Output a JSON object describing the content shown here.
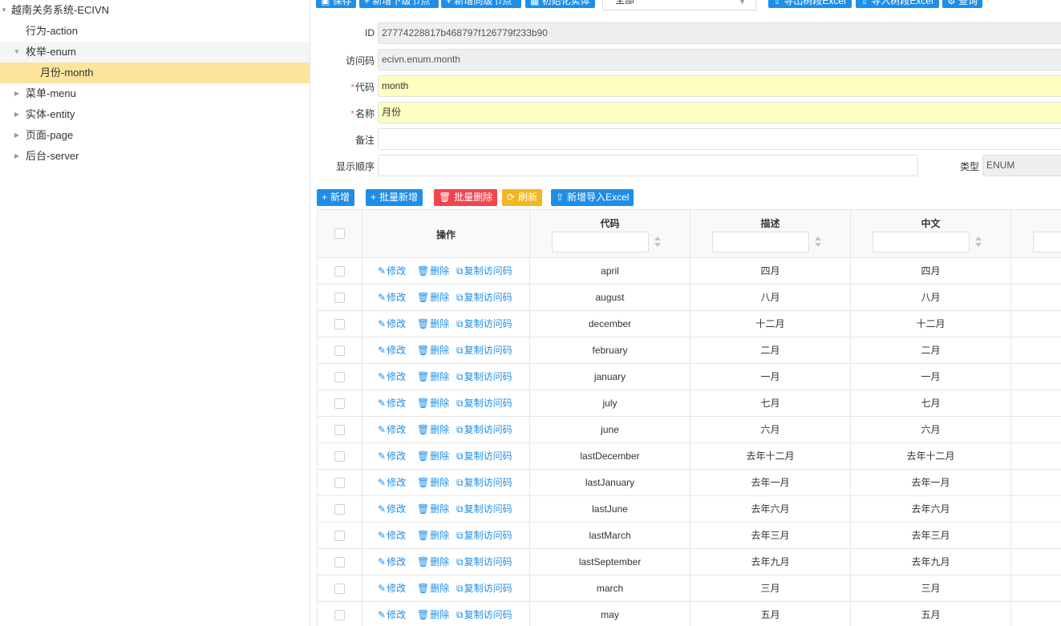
{
  "tree": {
    "root_label": "越南关务系统-ECIVN",
    "items": [
      {
        "label": "行为-action",
        "expanded": false,
        "has_children": false
      },
      {
        "label": "枚举-enum",
        "expanded": true,
        "has_children": true
      },
      {
        "label": "月份-month",
        "selected": true,
        "has_children": false
      },
      {
        "label": "菜单-menu",
        "expanded": false,
        "has_children": true
      },
      {
        "label": "实体-entity",
        "expanded": false,
        "has_children": true
      },
      {
        "label": "页面-page",
        "expanded": false,
        "has_children": true
      },
      {
        "label": "后台-server",
        "expanded": false,
        "has_children": true
      }
    ]
  },
  "toolbar": {
    "save": "保存",
    "add_child": "新增下级节点",
    "add_sibling": "新增同级节点",
    "init_entity": "初始化实体",
    "filter_value": "全部",
    "export_excel": "导出树段Excel",
    "import_excel": "导入树段Excel",
    "query": "查询"
  },
  "form": {
    "id_label": "ID",
    "id_value": "27774228817b468797f126779f233b90",
    "access_label": "访问码",
    "access_value": "ecivn.enum.month",
    "code_label": "代码",
    "code_value": "month",
    "name_label": "名称",
    "name_value": "月份",
    "remark_label": "备注",
    "remark_value": "",
    "order_label": "显示顺序",
    "order_value": "",
    "type_label": "类型",
    "type_value": "ENUM"
  },
  "actions": {
    "add": "新增",
    "batch_add": "批量新增",
    "batch_delete": "批量删除",
    "refresh": "刷新",
    "import_excel": "新增导入Excel"
  },
  "table": {
    "headers": {
      "op": "操作",
      "code": "代码",
      "desc": "描述",
      "zh": "中文"
    },
    "op_labels": {
      "edit": "修改",
      "delete": "删除",
      "copy": "复制访问码"
    },
    "rows": [
      {
        "code": "april",
        "desc": "四月",
        "zh": "四月"
      },
      {
        "code": "august",
        "desc": "八月",
        "zh": "八月"
      },
      {
        "code": "december",
        "desc": "十二月",
        "zh": "十二月"
      },
      {
        "code": "february",
        "desc": "二月",
        "zh": "二月"
      },
      {
        "code": "january",
        "desc": "一月",
        "zh": "一月"
      },
      {
        "code": "july",
        "desc": "七月",
        "zh": "七月"
      },
      {
        "code": "june",
        "desc": "六月",
        "zh": "六月"
      },
      {
        "code": "lastDecember",
        "desc": "去年十二月",
        "zh": "去年十二月"
      },
      {
        "code": "lastJanuary",
        "desc": "去年一月",
        "zh": "去年一月"
      },
      {
        "code": "lastJune",
        "desc": "去年六月",
        "zh": "去年六月"
      },
      {
        "code": "lastMarch",
        "desc": "去年三月",
        "zh": "去年三月"
      },
      {
        "code": "lastSeptember",
        "desc": "去年九月",
        "zh": "去年九月"
      },
      {
        "code": "march",
        "desc": "三月",
        "zh": "三月"
      },
      {
        "code": "may",
        "desc": "五月",
        "zh": "五月"
      }
    ]
  },
  "colors": {
    "primary": "#1e8ee8",
    "danger": "#f0464f",
    "warning": "#f4b521",
    "selected": "#fce49b",
    "required_bg": "#ffffc3"
  }
}
